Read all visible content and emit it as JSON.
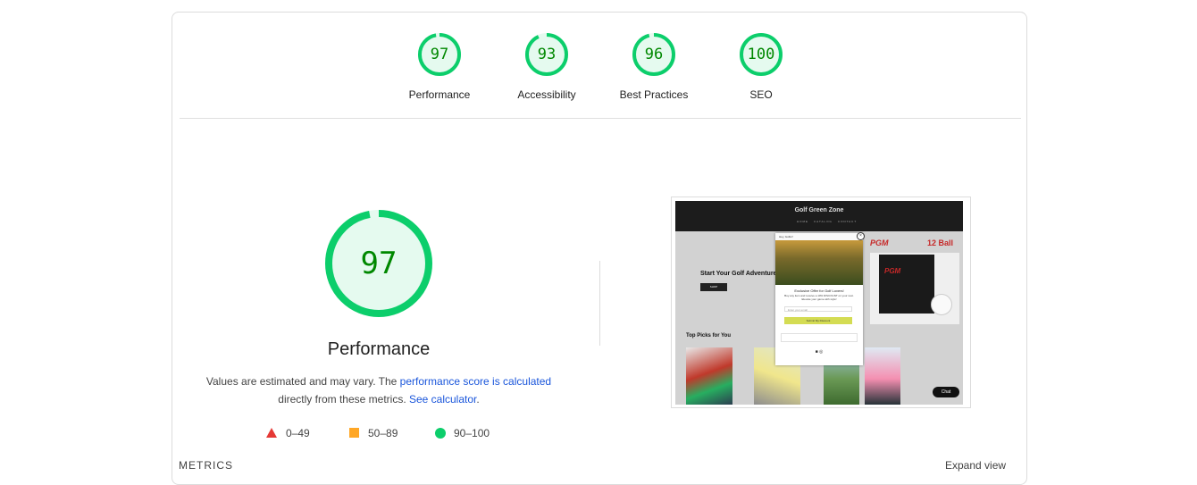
{
  "gauges": [
    {
      "label": "Performance",
      "score": "97",
      "fraction": 0.97
    },
    {
      "label": "Accessibility",
      "score": "93",
      "fraction": 0.93
    },
    {
      "label": "Best Practices",
      "score": "96",
      "fraction": 0.96
    },
    {
      "label": "SEO",
      "score": "100",
      "fraction": 1.0
    }
  ],
  "main": {
    "score": "97",
    "fraction": 0.97,
    "title": "Performance",
    "desc_prefix": "Values are estimated and may vary. The ",
    "desc_link1": "performance score is calculated",
    "desc_middle": " directly from these metrics. ",
    "desc_link2": "See calculator",
    "desc_suffix": "."
  },
  "legend": [
    {
      "range": "0–49",
      "shape": "triangle",
      "color": "#e53935"
    },
    {
      "range": "50–89",
      "shape": "square",
      "color": "#ffa726"
    },
    {
      "range": "90–100",
      "shape": "circle",
      "color": "#0cce6b"
    }
  ],
  "screenshot": {
    "site_logo": "Golf Green Zone",
    "nav": [
      "HOME",
      "CATALOG",
      "CONTACT"
    ],
    "hero_text": "Start Your Golf Adventure",
    "hero_button": "SHOP",
    "section_title": "Top Picks for You",
    "brand": "PGM",
    "balls_text": "12 Ball",
    "popup_bar": "Hey, Golfer!",
    "popup_title": "Exclusive Offer for Golf Lovers!",
    "popup_text": "Buy any item and receive a 10% DISCOUNT on your next. Elevate your game with style!",
    "popup_input": "Enter your email",
    "popup_button": "Submit My Discount",
    "chat": "Chat"
  },
  "colors": {
    "pass": "#0cce6b",
    "pass_text": "#008800",
    "pass_fill": "#e5faef"
  },
  "footer": {
    "metrics": "METRICS",
    "expand": "Expand view"
  }
}
